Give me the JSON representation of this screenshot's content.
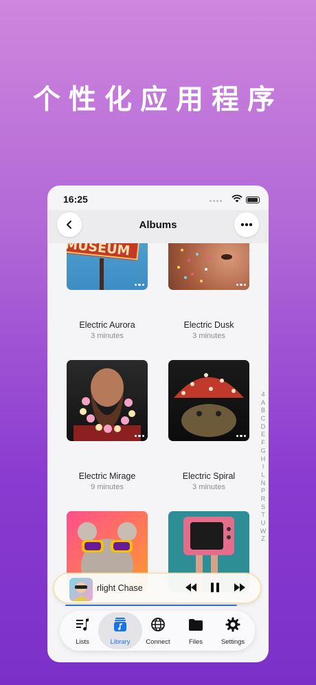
{
  "headline": "个性化应用程序",
  "status_bar": {
    "time": "16:25"
  },
  "nav": {
    "title": "Albums",
    "back_icon": "chevron-left-icon",
    "more_icon": "ellipsis-icon"
  },
  "albums": [
    {
      "title": "Electric Aurora",
      "duration": "3 minutes",
      "cover_text": "MUSEUM"
    },
    {
      "title": "Electric Dusk",
      "duration": "3 minutes"
    },
    {
      "title": "Electric Mirage",
      "duration": "9 minutes"
    },
    {
      "title": "Electric Spiral",
      "duration": "3 minutes"
    },
    {
      "title": "",
      "duration": ""
    },
    {
      "title": "",
      "duration": ""
    }
  ],
  "index_letters": [
    "4",
    "A",
    "B",
    "C",
    "D",
    "E",
    "F",
    "G",
    "H",
    "I",
    "L",
    "N",
    "P",
    "R",
    "S",
    "T",
    "U",
    "W",
    "Z"
  ],
  "mini_player": {
    "title": "Starlight Chase",
    "visible_title": "rlight Chase"
  },
  "tabs": [
    {
      "label": "Lists",
      "icon": "music-list-icon"
    },
    {
      "label": "Library",
      "icon": "music-library-icon",
      "active": true
    },
    {
      "label": "Connect",
      "icon": "globe-icon"
    },
    {
      "label": "Files",
      "icon": "folder-icon"
    },
    {
      "label": "Settings",
      "icon": "gear-icon"
    }
  ],
  "colors": {
    "accent": "#1a73e8",
    "background_top": "#cf86dd",
    "background_bottom": "#7b30c8"
  }
}
